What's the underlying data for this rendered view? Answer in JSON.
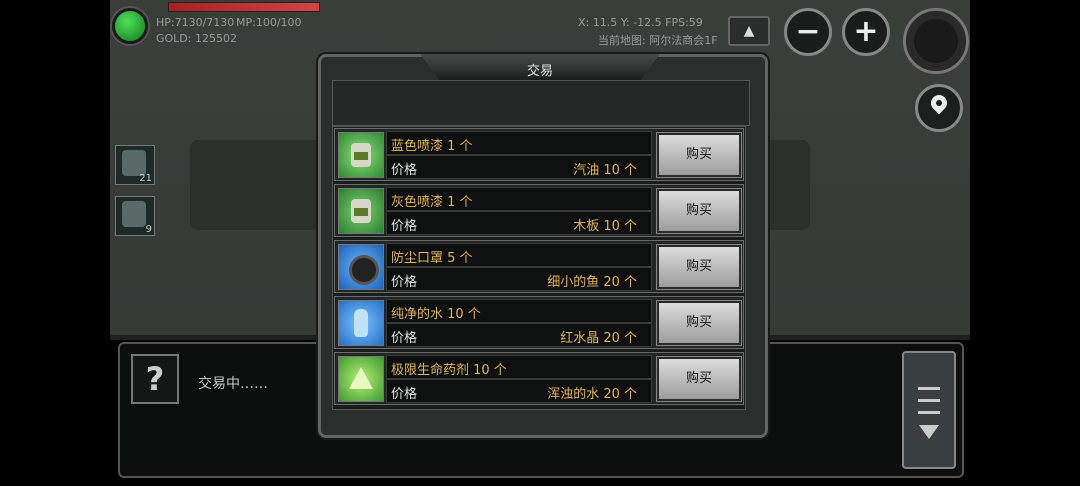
{
  "hud": {
    "hp_text": "HP:7130/7130",
    "mp_text": "MP:100/100",
    "gold_text": "GOLD: 125502",
    "coords_text": "X: 11.5 Y: -12.5  FPS:59",
    "map_text": "当前地图: 阿尔法商会1F",
    "minus_label": "−",
    "plus_label": "+",
    "up_label": "▲"
  },
  "inventory": [
    {
      "count": "21"
    },
    {
      "count": "9"
    }
  ],
  "dialog": {
    "title": "交易",
    "items": [
      {
        "name": "蓝色喷漆 1 个",
        "price_label": "价格",
        "price": "汽油 10 个",
        "buy": "购买"
      },
      {
        "name": "灰色喷漆 1 个",
        "price_label": "价格",
        "price": "木板 10 个",
        "buy": "购买"
      },
      {
        "name": "防尘口罩 5 个",
        "price_label": "价格",
        "price": "细小的鱼 20 个",
        "buy": "购买"
      },
      {
        "name": "纯净的水 10 个",
        "price_label": "价格",
        "price": "红水晶 20 个",
        "buy": "购买"
      },
      {
        "name": "极限生命药剂 10 个",
        "price_label": "价格",
        "price": "浑浊的水 20 个",
        "buy": "购买"
      }
    ]
  },
  "chat": {
    "avatar_label": "?",
    "status": "交易中……"
  }
}
